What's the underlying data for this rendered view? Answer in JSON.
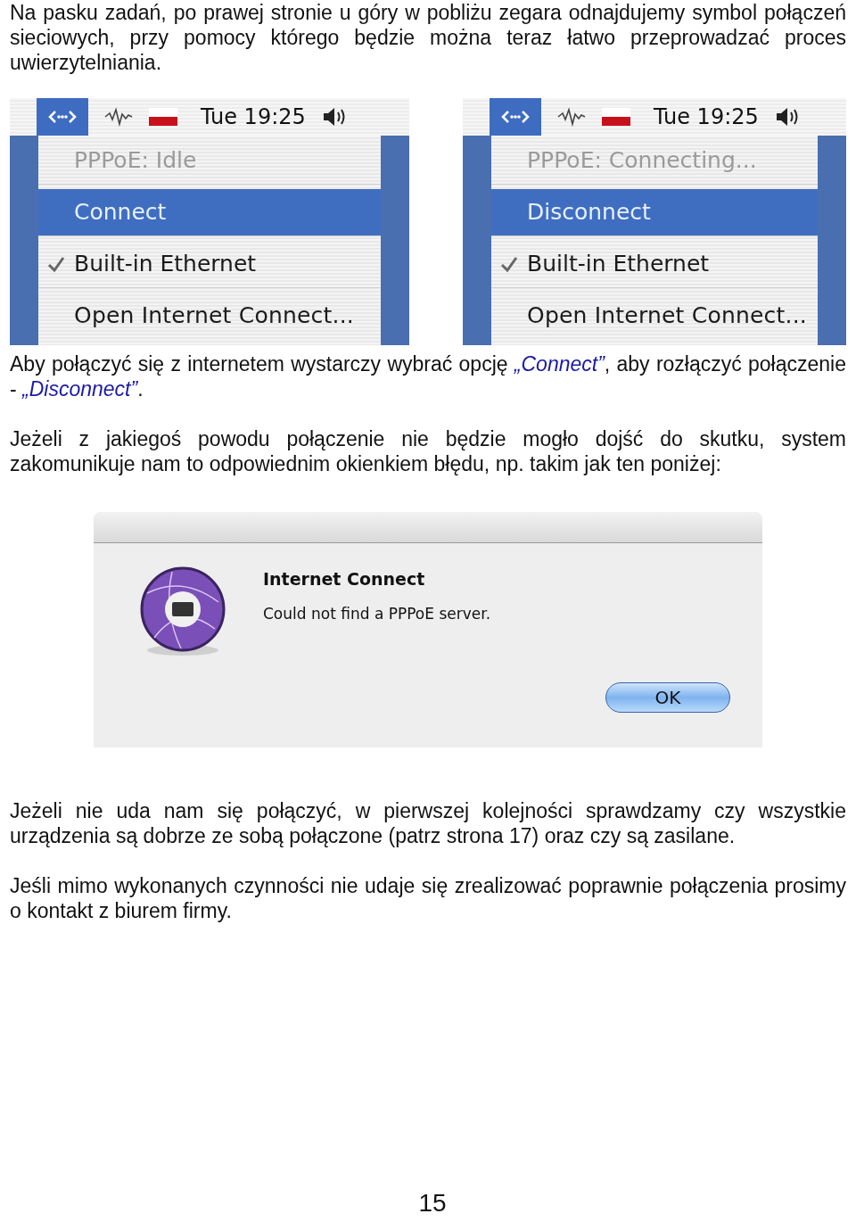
{
  "intro": "Na pasku zadań, po prawej stronie u góry w pobliżu zegara odnajdujemy symbol połączeń sieciowych, przy pomocy którego będzie można teraz łatwo przeprowadzać proces uwierzytelniania.",
  "screenshots": [
    {
      "clock": "Tue 19:25",
      "network_menu_open": true,
      "items": [
        {
          "kind": "status",
          "label": "PPPoE: Idle",
          "selected": false,
          "checked": false,
          "disabled": true
        },
        {
          "kind": "action",
          "label": "Connect",
          "selected": true,
          "checked": false,
          "disabled": false
        },
        {
          "kind": "network",
          "label": "Built-in Ethernet",
          "selected": false,
          "checked": true,
          "disabled": false
        },
        {
          "kind": "command",
          "label": "Open Internet Connect...",
          "selected": false,
          "checked": false,
          "disabled": false
        }
      ]
    },
    {
      "clock": "Tue 19:25",
      "network_menu_open": true,
      "items": [
        {
          "kind": "status",
          "label": "PPPoE: Connecting...",
          "selected": false,
          "checked": false,
          "disabled": true
        },
        {
          "kind": "action",
          "label": "Disconnect",
          "selected": true,
          "checked": false,
          "disabled": false
        },
        {
          "kind": "network",
          "label": "Built-in Ethernet",
          "selected": false,
          "checked": true,
          "disabled": false
        },
        {
          "kind": "command",
          "label": "Open Internet Connect...",
          "selected": false,
          "checked": false,
          "disabled": false
        }
      ]
    }
  ],
  "instructions": [
    {
      "kind": "text",
      "text": "Aby połączyć się z internetem wystarczy wybrać opcję "
    },
    {
      "kind": "term",
      "text": "„Connect”"
    },
    {
      "kind": "text",
      "text": ", aby rozłączyć połączenie - "
    },
    {
      "kind": "term",
      "text": "„Disconnect”"
    },
    {
      "kind": "text",
      "text": "."
    }
  ],
  "error_intro": "Jeżeli z jakiegoś powodu połączenie nie będzie mogło dojść do skutku, system zakomunikuje nam to odpowiednim okienkiem błędu, np. takim jak ten poniżej:",
  "dialog": {
    "title": "Internet Connect",
    "message": "Could not find a PPPoE server.",
    "button": "OK"
  },
  "troubleshooting": [
    "Jeżeli nie uda nam się połączyć, w pierwszej kolejności sprawdzamy czy wszystkie urządzenia są dobrze ze sobą połączone (patrz strona 17) oraz czy są zasilane.",
    "Jeśli mimo wykonanych czynności nie udaje się zrealizować poprawnie połączenia prosimy o kontakt z biurem firmy."
  ],
  "page_number": "15"
}
